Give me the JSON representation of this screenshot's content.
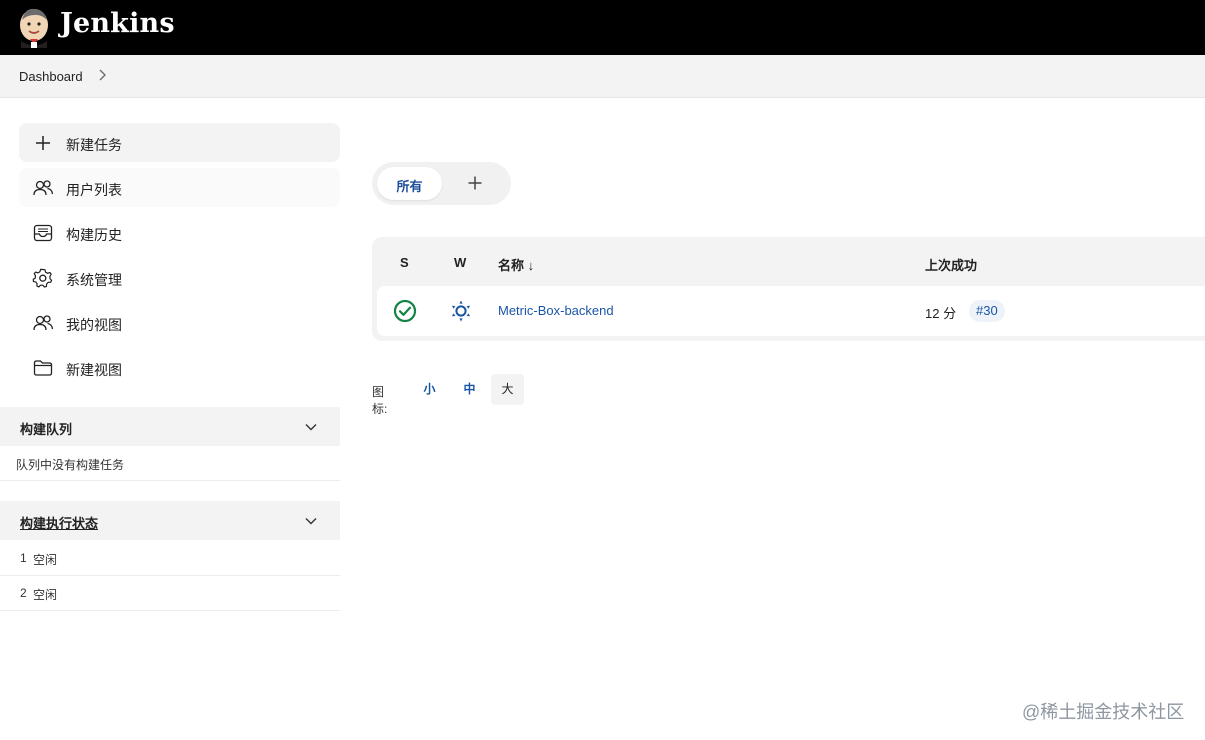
{
  "header": {
    "brand": "Jenkins",
    "logo_icon": "jenkins-butler-icon"
  },
  "breadcrumb": {
    "items": [
      "Dashboard"
    ]
  },
  "sidebar": {
    "tasks": [
      {
        "label": "新建任务",
        "icon": "plus-icon"
      },
      {
        "label": "用户列表",
        "icon": "people-icon"
      },
      {
        "label": "构建历史",
        "icon": "inbox-icon"
      },
      {
        "label": "系统管理",
        "icon": "gear-icon"
      },
      {
        "label": "我的视图",
        "icon": "people-icon"
      },
      {
        "label": "新建视图",
        "icon": "folder-icon"
      }
    ],
    "build_queue": {
      "title": "构建队列",
      "empty_text": "队列中没有构建任务"
    },
    "executors": {
      "title": "构建执行状态",
      "rows": [
        {
          "num": "1",
          "state": "空闲"
        },
        {
          "num": "2",
          "state": "空闲"
        }
      ]
    }
  },
  "views": {
    "tabs": [
      {
        "label": "所有",
        "active": true
      }
    ],
    "add_icon": "plus-icon"
  },
  "jobs_table": {
    "headers": {
      "status": "S",
      "weather": "W",
      "name": "名称 ↓",
      "last_success": "上次成功"
    },
    "rows": [
      {
        "status_icon": "check-circle-icon",
        "weather_icon": "sunny-icon",
        "name": "Metric-Box-backend",
        "last_success": "12 分",
        "build": "#30"
      }
    ]
  },
  "icon_size": {
    "label": "图标:",
    "options": [
      "小",
      "中",
      "大"
    ],
    "selected": "大"
  },
  "watermark": "@稀土掘金技术社区",
  "colors": {
    "header_bg": "#000000",
    "link": "#1a56a6",
    "success": "#138347",
    "panel_bg": "#f3f3f3"
  }
}
